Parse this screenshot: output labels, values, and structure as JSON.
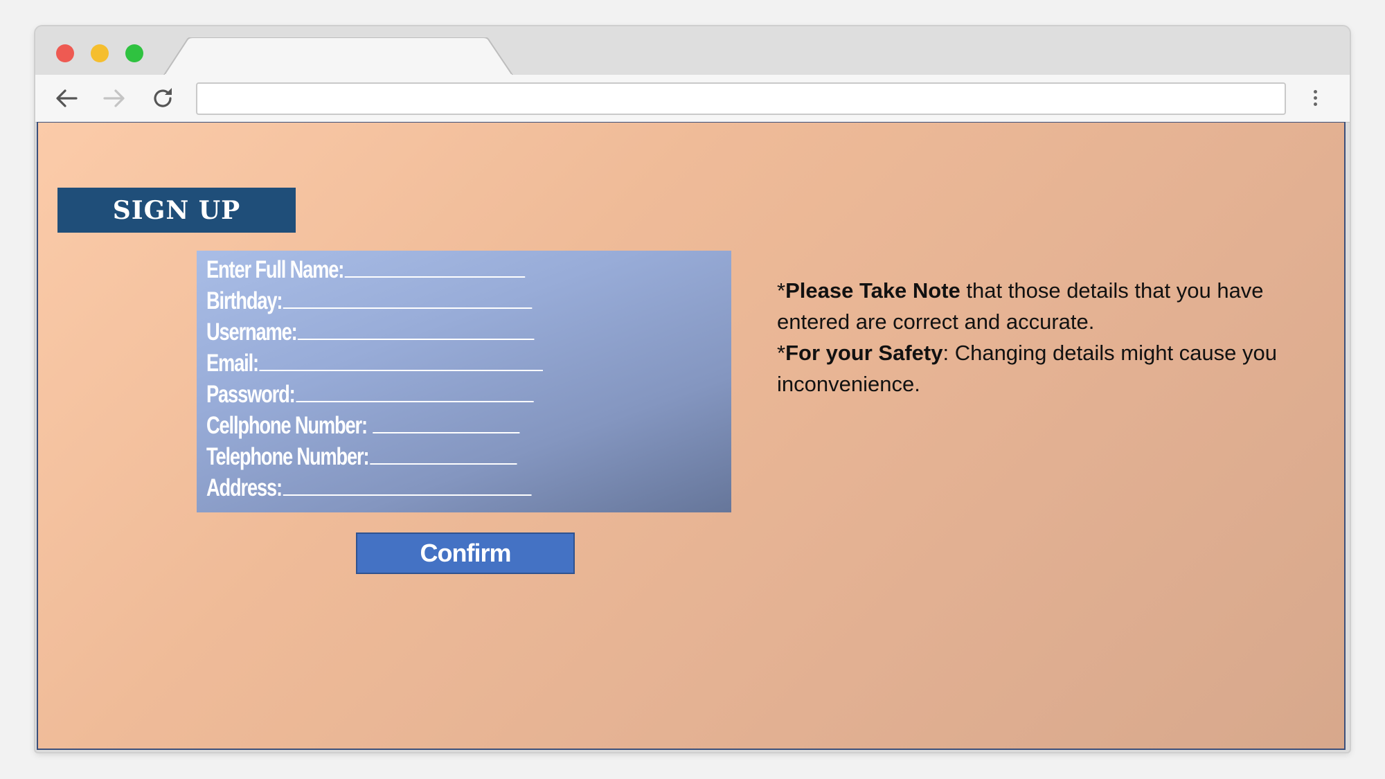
{
  "browser": {
    "address_value": "",
    "icons": {
      "back": "arrow-left-icon",
      "forward": "arrow-right-icon",
      "reload": "reload-icon",
      "menu": "vertical-dots-icon"
    },
    "window_controls": {
      "close_color": "#ee5a52",
      "minimize_color": "#f5be2e",
      "maximize_color": "#2fc240"
    }
  },
  "page": {
    "badge": "SIGN UP",
    "form": {
      "fields": [
        {
          "label": "Enter Full Name:"
        },
        {
          "label": "Birthday:"
        },
        {
          "label": "Username:"
        },
        {
          "label": "Email:"
        },
        {
          "label": "Password:"
        },
        {
          "label": "Cellphone Number: "
        },
        {
          "label": "Telephone Number:"
        },
        {
          "label": "Address:"
        }
      ]
    },
    "confirm_label": "Confirm",
    "notes": [
      {
        "prefix": "*",
        "bold": "Please Take Note",
        "text": " that those details that you have entered are correct and accurate."
      },
      {
        "prefix": "*",
        "bold": "For your Safety",
        "text": ": Changing details might cause you inconvenience."
      }
    ],
    "colors": {
      "badge_bg": "#1f4e79",
      "button_bg": "#4472c4",
      "panel_start": "#a9bde6",
      "panel_end": "#66769a",
      "page_bg_start": "#fbcba9",
      "page_bg_end": "#d7a88c"
    }
  }
}
